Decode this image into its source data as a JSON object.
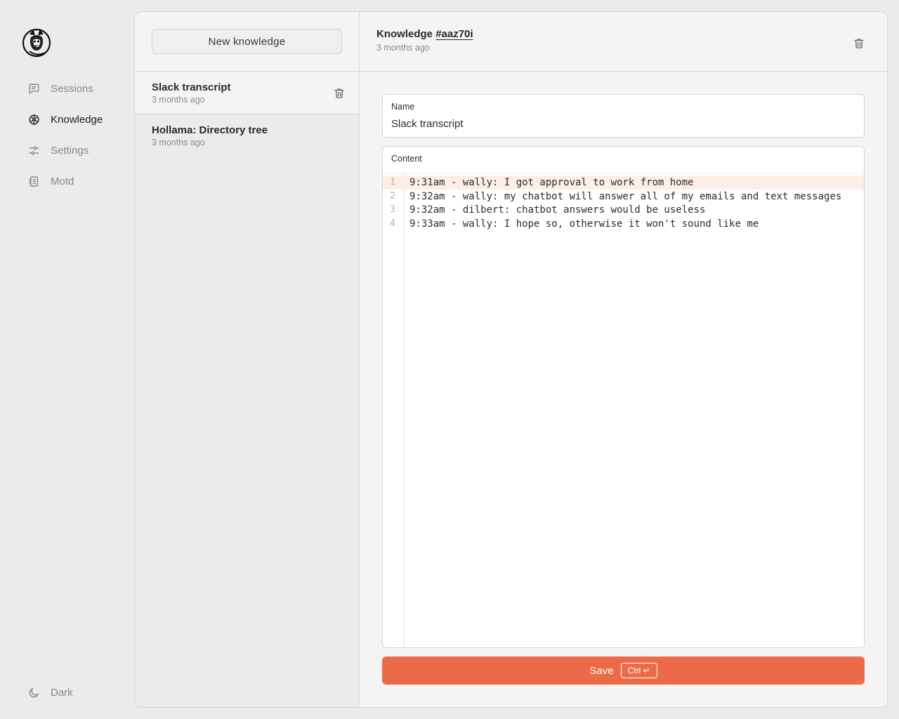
{
  "nav": {
    "items": [
      {
        "label": "Sessions",
        "icon": "chat-icon",
        "active": false
      },
      {
        "label": "Knowledge",
        "icon": "brain-icon",
        "active": true
      },
      {
        "label": "Settings",
        "icon": "sliders-icon",
        "active": false
      },
      {
        "label": "Motd",
        "icon": "notebook-icon",
        "active": false
      }
    ],
    "theme_toggle": {
      "label": "Dark",
      "icon": "moon-icon"
    }
  },
  "list": {
    "new_button": "New knowledge",
    "items": [
      {
        "title": "Slack transcript",
        "date": "3 months ago",
        "selected": true
      },
      {
        "title": "Hollama: Directory tree",
        "date": "3 months ago",
        "selected": false
      }
    ]
  },
  "detail": {
    "title_prefix": "Knowledge",
    "id": "#aaz70i",
    "date": "3 months ago",
    "name_label": "Name",
    "name_value": "Slack transcript",
    "content_label": "Content",
    "lines": [
      {
        "n": "1",
        "text": "9:31am - wally: I got approval to work from home"
      },
      {
        "n": "2",
        "text": "9:32am - wally: my chatbot will answer all of my emails and text messages"
      },
      {
        "n": "3",
        "text": "9:32am - dilbert: chatbot answers would be useless"
      },
      {
        "n": "4",
        "text": "9:33am - wally: I hope so, otherwise it won't sound like me"
      }
    ],
    "save_label": "Save",
    "shortcut": "Ctrl ↵"
  },
  "colors": {
    "accent": "#ec6a47",
    "current_line": "#fdeee6",
    "background": "#ebebeb",
    "panel": "#f4f4f4"
  }
}
